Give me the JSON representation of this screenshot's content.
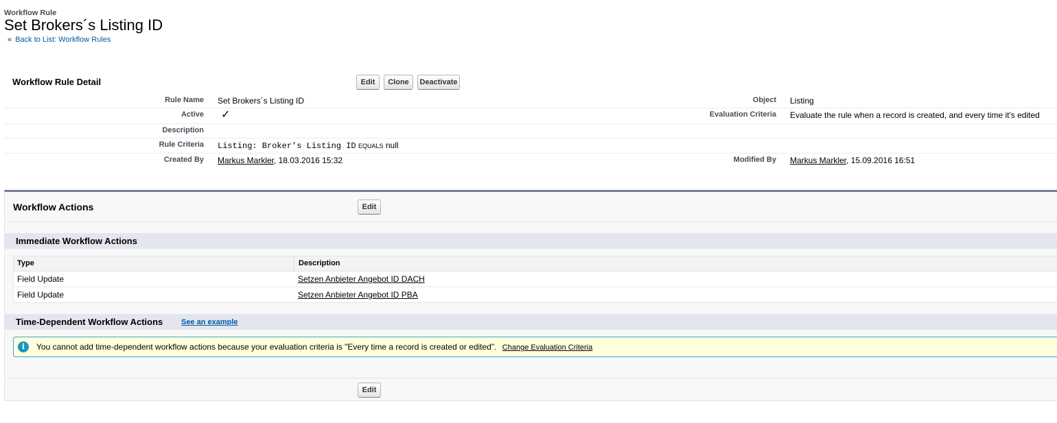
{
  "header": {
    "breadcrumb_label": "Workflow Rule",
    "page_title": "Set Brokers´s Listing ID",
    "back_prefix": "«",
    "back_link": "Back to List: Workflow Rules"
  },
  "detail": {
    "title": "Workflow Rule Detail",
    "buttons": {
      "edit": "Edit",
      "clone": "Clone",
      "deactivate": "Deactivate"
    },
    "fields": {
      "rule_name_label": "Rule Name",
      "rule_name_value": "Set Brokers´s Listing ID",
      "object_label": "Object",
      "object_value": "Listing",
      "active_label": "Active",
      "active_checked": true,
      "eval_label": "Evaluation Criteria",
      "eval_value": "Evaluate the rule when a record is created, and every time it's edited",
      "description_label": "Description",
      "criteria_label": "Rule Criteria",
      "criteria_field": "Listing: Broker's Listing ID",
      "criteria_operator": "EQUALS",
      "criteria_value": "null",
      "created_by_label": "Created By",
      "created_by_user": "Markus Markler",
      "created_by_date": ", 18.03.2016 15:32",
      "modified_by_label": "Modified By",
      "modified_by_user": "Markus Markler",
      "modified_by_date": ", 15.09.2016 16:51"
    }
  },
  "actions": {
    "title": "Workflow Actions",
    "edit_label": "Edit",
    "immediate": {
      "title": "Immediate Workflow Actions",
      "columns": [
        "Type",
        "Description"
      ],
      "rows": [
        {
          "type": "Field Update",
          "description": "Setzen Anbieter Angebot ID DACH"
        },
        {
          "type": "Field Update",
          "description": "Setzen Anbieter Angebot ID PBA"
        }
      ]
    },
    "time_dependent": {
      "title": "Time-Dependent Workflow Actions",
      "example_link": "See an example",
      "info_icon": "info-icon",
      "message": "You cannot add time-dependent workflow actions because your evaluation criteria is \"Every time a record is created or edited\".",
      "change_link": "Change Evaluation Criteria"
    },
    "bottom_edit_label": "Edit"
  },
  "colors": {
    "link_blue": "#015ba7",
    "section_band": "#e3e6ed",
    "accent_bar": "#747e96",
    "info_bg": "#ffffdc",
    "info_border": "#39a3d6",
    "info_icon": "#1797c0"
  }
}
